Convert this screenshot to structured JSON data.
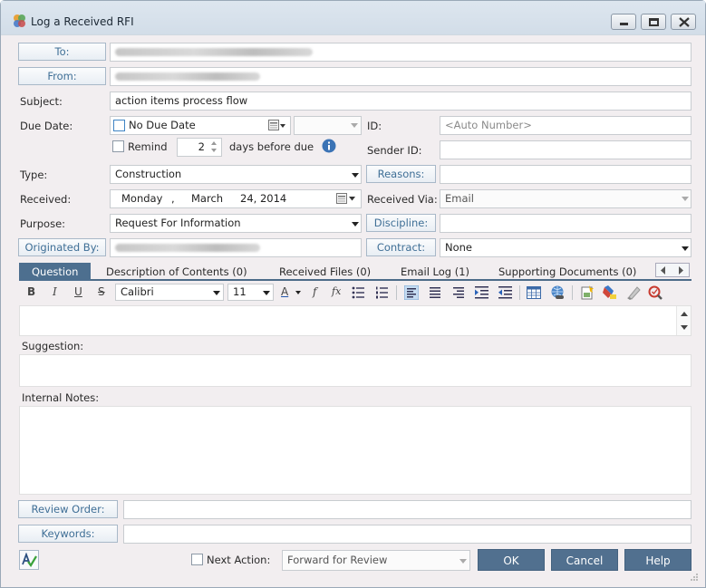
{
  "window": {
    "title": "Log a Received RFI"
  },
  "form": {
    "to_label": "To:",
    "from_label": "From:",
    "subject_label": "Subject:",
    "subject_value": "action items process flow",
    "due_date_label": "Due Date:",
    "no_due_date_label": "No Due Date",
    "remind_label": "Remind",
    "remind_days_value": "2",
    "days_before_due_label": "days before due",
    "id_label": "ID:",
    "id_placeholder": "<Auto Number>",
    "sender_id_label": "Sender ID:",
    "type_label": "Type:",
    "type_value": "Construction",
    "reasons_label": "Reasons:",
    "received_label": "Received:",
    "received_day": "Monday",
    "received_sep": ",",
    "received_month": "March",
    "received_daynum_year": "24, 2014",
    "received_via_label": "Received Via:",
    "received_via_value": "Email",
    "purpose_label": "Purpose:",
    "purpose_value": "Request For Information",
    "discipline_label": "Discipline:",
    "originated_by_label": "Originated By:",
    "contract_label": "Contract:",
    "contract_value": "None"
  },
  "tabs": [
    {
      "label": "Question",
      "active": true
    },
    {
      "label": "Description of Contents (0)"
    },
    {
      "label": "Received Files (0)"
    },
    {
      "label": "Email Log (1)"
    },
    {
      "label": "Supporting Documents (0)"
    }
  ],
  "toolbar": {
    "bold": "B",
    "italic": "I",
    "underline": "U",
    "strike": "S",
    "font_family": "Calibri",
    "font_size": "11",
    "font_color_glyph": "A",
    "function_glyph": "f",
    "function_x_glyph": "fx",
    "icons": [
      "bold-icon",
      "italic-icon",
      "underline-icon",
      "strikethrough-icon",
      "font-color-icon",
      "function-icon",
      "insert-function-icon",
      "bullet-list-icon",
      "numbered-list-icon",
      "align-left-icon",
      "align-center-icon",
      "align-right-icon",
      "indent-icon",
      "outdent-icon",
      "table-icon",
      "hyperlink-icon",
      "insert-image-icon",
      "highlight-icon",
      "eraser-icon",
      "spell-check-icon"
    ]
  },
  "sections": {
    "suggestion_label": "Suggestion:",
    "internal_notes_label": "Internal Notes:",
    "review_order_label": "Review Order:",
    "keywords_label": "Keywords:"
  },
  "footer": {
    "next_action_label": "Next Action:",
    "next_action_value": "Forward for Review",
    "ok_label": "OK",
    "cancel_label": "Cancel",
    "help_label": "Help"
  },
  "colors": {
    "accent": "#51708f",
    "link_label": "#3f6f96",
    "panel_bg": "#f2eef0",
    "tab_active": "#4d6f8f"
  }
}
